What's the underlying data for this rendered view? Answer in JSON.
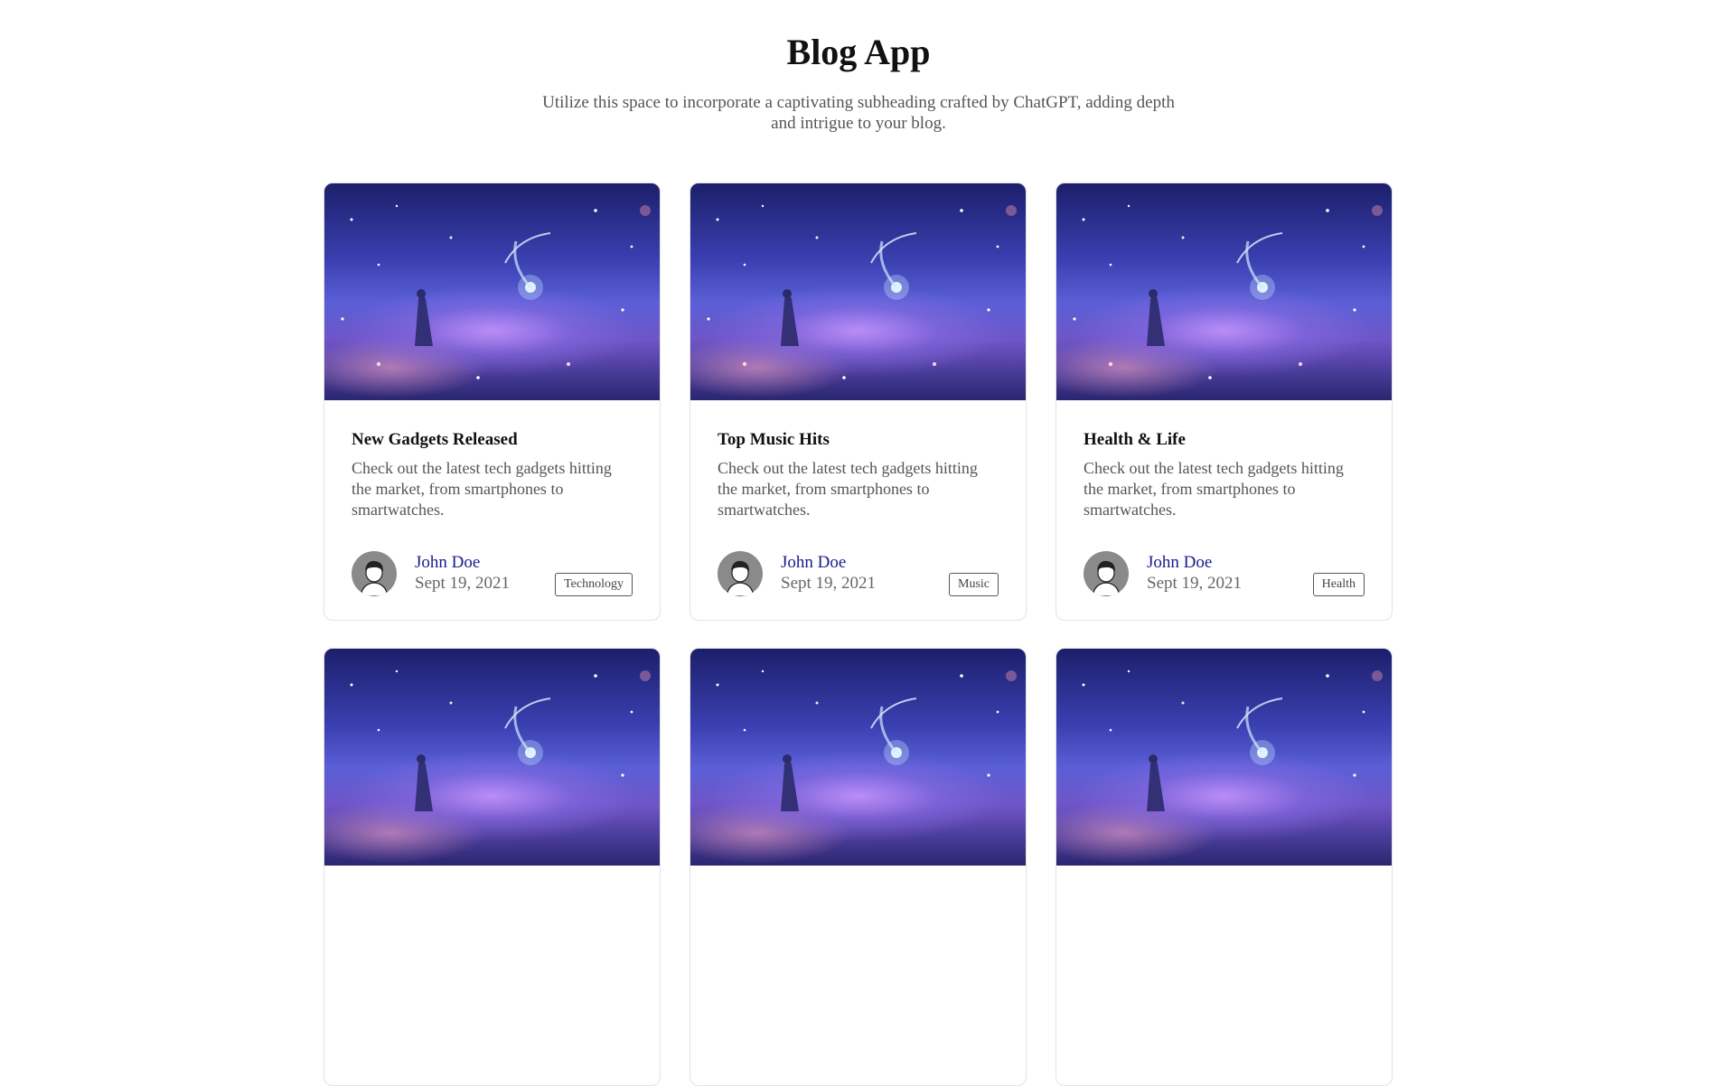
{
  "header": {
    "title": "Blog App",
    "subtitle": "Utilize this space to incorporate a captivating subheading crafted by ChatGPT, adding depth and intrigue to your blog."
  },
  "posts": [
    {
      "title": "New Gadgets Released",
      "description": "Check out the latest tech gadgets hitting the market, from smartphones to smartwatches.",
      "author": "John Doe",
      "date": "Sept 19, 2021",
      "tag": "Technology"
    },
    {
      "title": "Top Music Hits",
      "description": "Check out the latest tech gadgets hitting the market, from smartphones to smartwatches.",
      "author": "John Doe",
      "date": "Sept 19, 2021",
      "tag": "Music"
    },
    {
      "title": "Health & Life",
      "description": "Check out the latest tech gadgets hitting the market, from smartphones to smartwatches.",
      "author": "John Doe",
      "date": "Sept 19, 2021",
      "tag": "Health"
    },
    {
      "title": "",
      "description": "",
      "author": "",
      "date": "",
      "tag": ""
    },
    {
      "title": "",
      "description": "",
      "author": "",
      "date": "",
      "tag": ""
    },
    {
      "title": "",
      "description": "",
      "author": "",
      "date": "",
      "tag": ""
    }
  ]
}
